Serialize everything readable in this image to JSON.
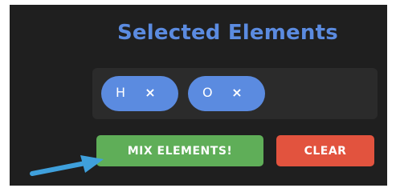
{
  "title": "Selected Elements",
  "selected_elements": [
    {
      "symbol": "H",
      "remove_glyph": "×"
    },
    {
      "symbol": "O",
      "remove_glyph": "×"
    }
  ],
  "actions": {
    "mix_label": "MIX ELEMENTS!",
    "clear_label": "CLEAR"
  },
  "colors": {
    "accent_blue": "#5b8be0",
    "mix_green": "#5fae58",
    "clear_red": "#e2533e",
    "background": "#1f1f1f",
    "annotation_arrow": "#3fa0dc"
  },
  "annotation": {
    "icon": "pointer-arrow-icon"
  }
}
